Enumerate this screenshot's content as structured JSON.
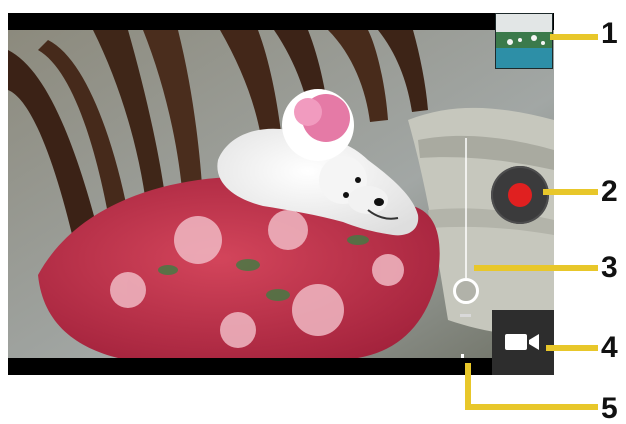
{
  "callouts": {
    "labels": [
      "1",
      "2",
      "3",
      "4",
      "5"
    ],
    "line_color": "#e8c72a"
  },
  "controls": {
    "gallery_thumbnail": "gallery-thumbnail",
    "record_button_color": "#e02020",
    "zoom_level": 0.15,
    "mode_icon": "video-camera-icon",
    "settings_icon": "sliders-icon"
  }
}
